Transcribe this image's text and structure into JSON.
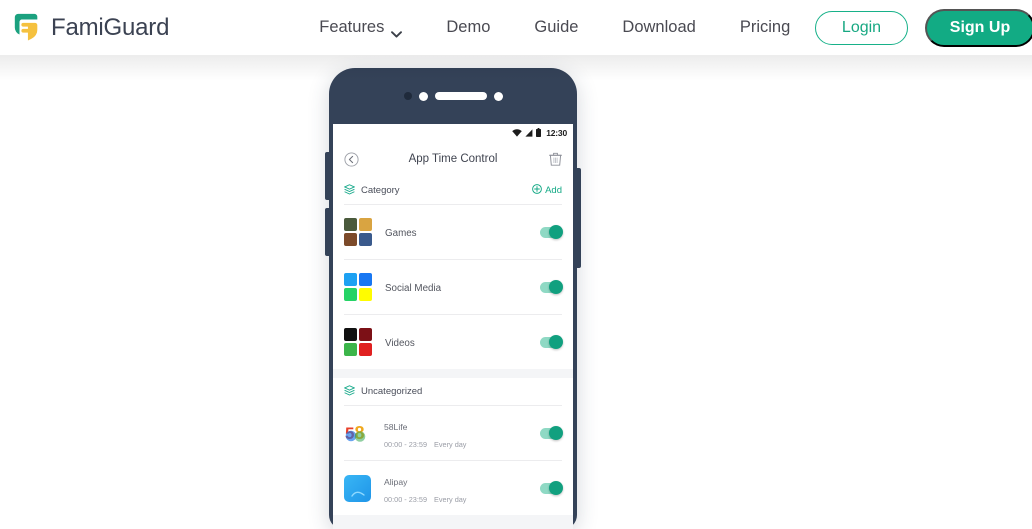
{
  "header": {
    "brand": "FamiGuard",
    "logo_icon": "famiguard-shield-logo",
    "nav": [
      {
        "label": "Features",
        "has_caret": true,
        "caret_icon": "chevron-down-icon"
      },
      {
        "label": "Demo",
        "has_caret": false
      },
      {
        "label": "Guide",
        "has_caret": false
      },
      {
        "label": "Download",
        "has_caret": false
      },
      {
        "label": "Pricing",
        "has_caret": false
      }
    ],
    "login_label": "Login",
    "signup_label": "Sign Up",
    "accent_color": "#12ab84",
    "login_border_color": "#17b189"
  },
  "phone": {
    "frame_color": "#344258",
    "statusbar": {
      "wifi_icon": "wifi-icon",
      "signal_icon": "signal-bars-icon",
      "battery_icon": "battery-icon",
      "time": "12:30"
    },
    "appbar": {
      "back_icon": "back-arrow-circle-icon",
      "title": "App Time Control",
      "delete_icon": "trash-icon"
    },
    "sections": [
      {
        "id": "category",
        "header_icon": "layers-icon",
        "header_label": "Category",
        "add_icon": "plus-circle-icon",
        "add_label": "Add",
        "rows": [
          {
            "name": "Games",
            "icon_type": "grid",
            "icon_name": "games-app-icons",
            "icon_colors": [
              "#4a5a3c",
              "#d9a441",
              "#7c4a2a",
              "#3a5a8c"
            ],
            "toggle_on": true
          },
          {
            "name": "Social Media",
            "icon_type": "grid",
            "icon_name": "social-media-app-icons",
            "icon_colors": [
              "#1da1f2",
              "#1877f2",
              "#25d366",
              "#fffc00"
            ],
            "toggle_on": true
          },
          {
            "name": "Videos",
            "icon_type": "grid",
            "icon_name": "videos-app-icons",
            "icon_colors": [
              "#111111",
              "#7c1016",
              "#3cb54a",
              "#e02020"
            ],
            "toggle_on": true
          }
        ]
      },
      {
        "id": "uncategorized",
        "header_icon": "layers-icon",
        "header_label": "Uncategorized",
        "add_label": "",
        "rows": [
          {
            "name": "58Life",
            "icon_type": "logo-58",
            "icon_name": "58life-app-icon",
            "time_range": "00:00 - 23:59",
            "repeat": "Every day",
            "toggle_on": true
          },
          {
            "name": "Alipay",
            "icon_type": "square",
            "icon_name": "alipay-app-icon",
            "icon_color": "#2ca6f0",
            "time_range": "00:00 - 23:59",
            "repeat": "Every day",
            "toggle_on": true
          }
        ]
      }
    ]
  }
}
